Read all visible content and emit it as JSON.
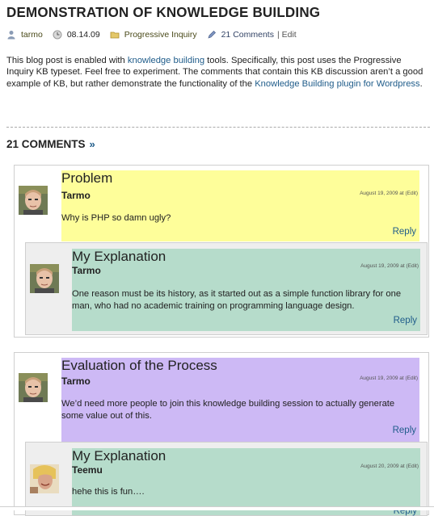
{
  "post": {
    "title": "DEMONSTRATION OF KNOWLEDGE BUILDING",
    "author": "tarmo",
    "date": "08.14.09",
    "category": "Progressive Inquiry",
    "comments_link": "21 Comments",
    "edit": "| Edit",
    "intro_1": "This blog post is enabled with ",
    "intro_link_1": "knowledge building",
    "intro_2": " tools. Specifically, this post uses the Progressive Inquiry KB typeset. Feel free to experiment. The comments that contain this KB discussion aren’t a good example of KB, but rather demonstrate the functionality of the ",
    "intro_link_2": "Knowledge Building plugin for Wordpress",
    "intro_3": "."
  },
  "comments_heading": "21 COMMENTS",
  "comments_heading_arrow": "»",
  "threads": [
    {
      "note": {
        "kb_type": "Problem",
        "author": "Tarmo",
        "date": "August 19, 2009 at (Edit)",
        "body": "Why is PHP so damn ugly?",
        "reply": "Reply",
        "color": "#fefe9a"
      },
      "children": [
        {
          "kb_type": "My Explanation",
          "author": "Tarmo",
          "date": "August 19, 2009 at (Edit)",
          "body": "One reason must be its history, as it started out as a simple function library for one man, who had no academic training on programming language design.",
          "reply": "Reply",
          "color": "#b6dccb"
        }
      ]
    },
    {
      "note": {
        "kb_type": "Evaluation of the Process",
        "author": "Tarmo",
        "date": "August 19, 2009 at (Edit)",
        "body": "We’d need more people to join this knowledge building session to actually generate some value out of this.",
        "reply": "Reply",
        "color": "#cdb9f5"
      },
      "children": [
        {
          "kb_type": "My Explanation",
          "author": "Teemu",
          "date": "August 20, 2009 at (Edit)",
          "body": "hehe this is fun….",
          "reply": "Reply",
          "color": "#b6dccb"
        }
      ]
    }
  ],
  "icons": {
    "author": "user-icon",
    "date": "clock-icon",
    "category": "folder-icon",
    "comments": "pencil-icon"
  }
}
